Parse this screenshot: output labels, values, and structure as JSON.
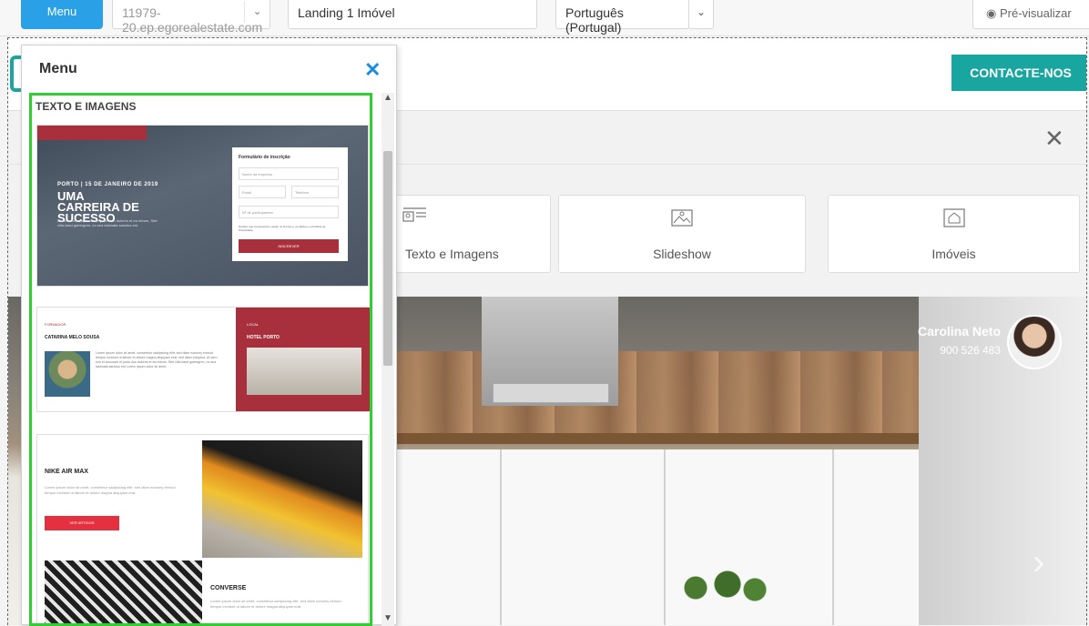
{
  "toolbar": {
    "menu_label": "Menu",
    "site_select": "11979-20.ep.egorealestate.com",
    "page_select": "Landing 1 Imóvel",
    "language_select": "Português (Portugal)",
    "preview_label": "Pré-visualizar"
  },
  "site_header": {
    "contact_button": "CONTACTE-NOS"
  },
  "widget_panel": {
    "cards": [
      {
        "label": "Texto e Imagens",
        "icon": "text-image-icon"
      },
      {
        "label": "Slideshow",
        "icon": "slideshow-icon"
      },
      {
        "label": "Imóveis",
        "icon": "property-icon"
      }
    ],
    "close_icon": "close-icon"
  },
  "hero": {
    "agent_name": "Carolina Neto",
    "agent_phone": "900 526 483"
  },
  "menu_panel": {
    "title": "Menu",
    "section_title": "TEXTO E IMAGENS",
    "templates": {
      "tpl1": {
        "date": "PORTO | 15 DE JANEIRO DE 2019",
        "heading": "UMA CARREIRA DE SUCESSO",
        "sub": "At vero eos et accusam et justo duo dolores et ea rebum. Stet clita kasd gubergren, no sea takimata sanctus est.",
        "form_title": "Formulário de inscrição",
        "field_company": "Nome da empresa",
        "field_email": "Email",
        "field_phone": "Telefone",
        "field_count": "Nº de participantes",
        "consent": "Declaro que compreendi e aceito os Termos e condições e a Política de Privacidade",
        "submit": "INSCREVER"
      },
      "tpl2": {
        "label_left": "FORMADOR",
        "name": "CATARINA MELO SOUSA",
        "text": "Lorem ipsum dolor sit amet, consetetur sadipscing elitr, sed diam nonumy eirmod tempor invidunt ut labore et dolore magna aliquyam erat, sed diam voluptua. At vero eos et accusam et justo duo dolores et ea rebum. Stet clita kasd gubergren, no sea takimata sanctus est Lorem ipsum dolor sit amet.",
        "label_right": "LOCAL",
        "venue": "HOTEL PORTO"
      },
      "tpl3": {
        "title1": "NIKE AIR MAX",
        "text1": "Lorem ipsum dolor sit amet, consetetur sadipscing elitr, sed diam nonumy eirmod tempor invidunt ut labore et dolore magna aliquyam erat.",
        "button": "VER ARTIGOS",
        "title2": "CONVERSE",
        "text2": "Lorem ipsum dolor sit amet, consetetur sadipscing elitr, sed diam nonumy eirmod tempor invidunt ut labore et dolore magna aliquyam erat."
      }
    }
  },
  "colors": {
    "accent_blue": "#2aa0e6",
    "brand_teal": "#1aa6a0",
    "selection_green": "#30d030",
    "template_red": "#a82f3c"
  }
}
